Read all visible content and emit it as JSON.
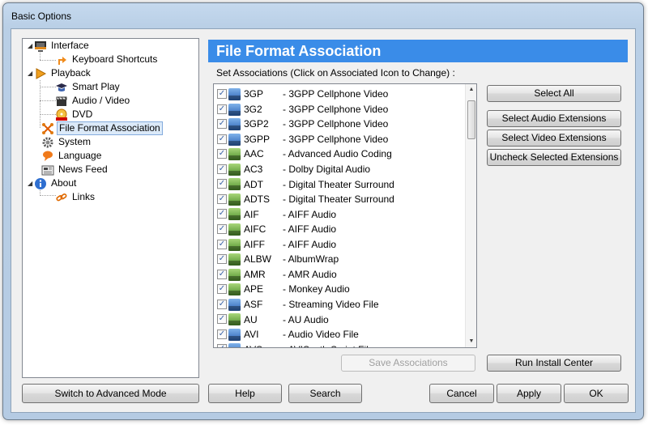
{
  "window": {
    "title": "Basic Options"
  },
  "tree": {
    "items": [
      {
        "label": "Interface",
        "icon": "monitor-icon"
      },
      {
        "label": "Keyboard Shortcuts",
        "icon": "shortcut-arrow-icon"
      },
      {
        "label": "Playback",
        "icon": "play-icon"
      },
      {
        "label": "Smart Play",
        "icon": "graduation-cap-icon"
      },
      {
        "label": "Audio / Video",
        "icon": "clapperboard-icon"
      },
      {
        "label": "DVD",
        "icon": "dvd-icon"
      },
      {
        "label": "File Format Association",
        "icon": "file-association-icon"
      },
      {
        "label": "System",
        "icon": "gear-icon"
      },
      {
        "label": "Language",
        "icon": "speech-bubble-icon"
      },
      {
        "label": "News Feed",
        "icon": "newspaper-icon"
      },
      {
        "label": "About",
        "icon": "info-icon"
      },
      {
        "label": "Links",
        "icon": "link-icon"
      }
    ],
    "selected": "File Format Association"
  },
  "panel": {
    "header": "File Format Association",
    "subtitle": "Set Associations (Click on Associated Icon to Change) :",
    "associations": [
      {
        "ext": "3GP",
        "desc": "- 3GPP Cellphone Video",
        "checked": true,
        "kind": "video"
      },
      {
        "ext": "3G2",
        "desc": "- 3GPP Cellphone Video",
        "checked": true,
        "kind": "video"
      },
      {
        "ext": "3GP2",
        "desc": "- 3GPP Cellphone Video",
        "checked": true,
        "kind": "video"
      },
      {
        "ext": "3GPP",
        "desc": "- 3GPP Cellphone Video",
        "checked": true,
        "kind": "video"
      },
      {
        "ext": "AAC",
        "desc": "- Advanced Audio Coding",
        "checked": true,
        "kind": "audio"
      },
      {
        "ext": "AC3",
        "desc": "- Dolby Digital Audio",
        "checked": true,
        "kind": "audio"
      },
      {
        "ext": "ADT",
        "desc": "- Digital Theater Surround",
        "checked": true,
        "kind": "audio"
      },
      {
        "ext": "ADTS",
        "desc": "- Digital Theater Surround",
        "checked": true,
        "kind": "audio"
      },
      {
        "ext": "AIF",
        "desc": "- AIFF Audio",
        "checked": true,
        "kind": "audio"
      },
      {
        "ext": "AIFC",
        "desc": "- AIFF Audio",
        "checked": true,
        "kind": "audio"
      },
      {
        "ext": "AIFF",
        "desc": "- AIFF Audio",
        "checked": true,
        "kind": "audio"
      },
      {
        "ext": "ALBW",
        "desc": "- AlbumWrap",
        "checked": true,
        "kind": "audio"
      },
      {
        "ext": "AMR",
        "desc": "- AMR Audio",
        "checked": true,
        "kind": "audio"
      },
      {
        "ext": "APE",
        "desc": "- Monkey Audio",
        "checked": true,
        "kind": "audio"
      },
      {
        "ext": "ASF",
        "desc": "- Streaming Video File",
        "checked": true,
        "kind": "video"
      },
      {
        "ext": "AU",
        "desc": "- AU Audio",
        "checked": true,
        "kind": "audio"
      },
      {
        "ext": "AVI",
        "desc": "- Audio Video File",
        "checked": true,
        "kind": "video"
      },
      {
        "ext": "AVS",
        "desc": "- AVISynth Script File",
        "checked": true,
        "kind": "video"
      }
    ],
    "buttons": {
      "select_all": "Select All",
      "select_audio": "Select Audio Extensions",
      "select_video": "Select Video Extensions",
      "uncheck_selected": "Uncheck Selected Extensions",
      "save_associations": "Save Associations",
      "run_install_center": "Run Install Center"
    }
  },
  "footer": {
    "switch_mode": "Switch to Advanced Mode",
    "help": "Help",
    "search": "Search",
    "cancel": "Cancel",
    "apply": "Apply",
    "ok": "OK"
  },
  "colors": {
    "header_bg": "#3a8ce8",
    "selection": "#dbe9f8"
  }
}
